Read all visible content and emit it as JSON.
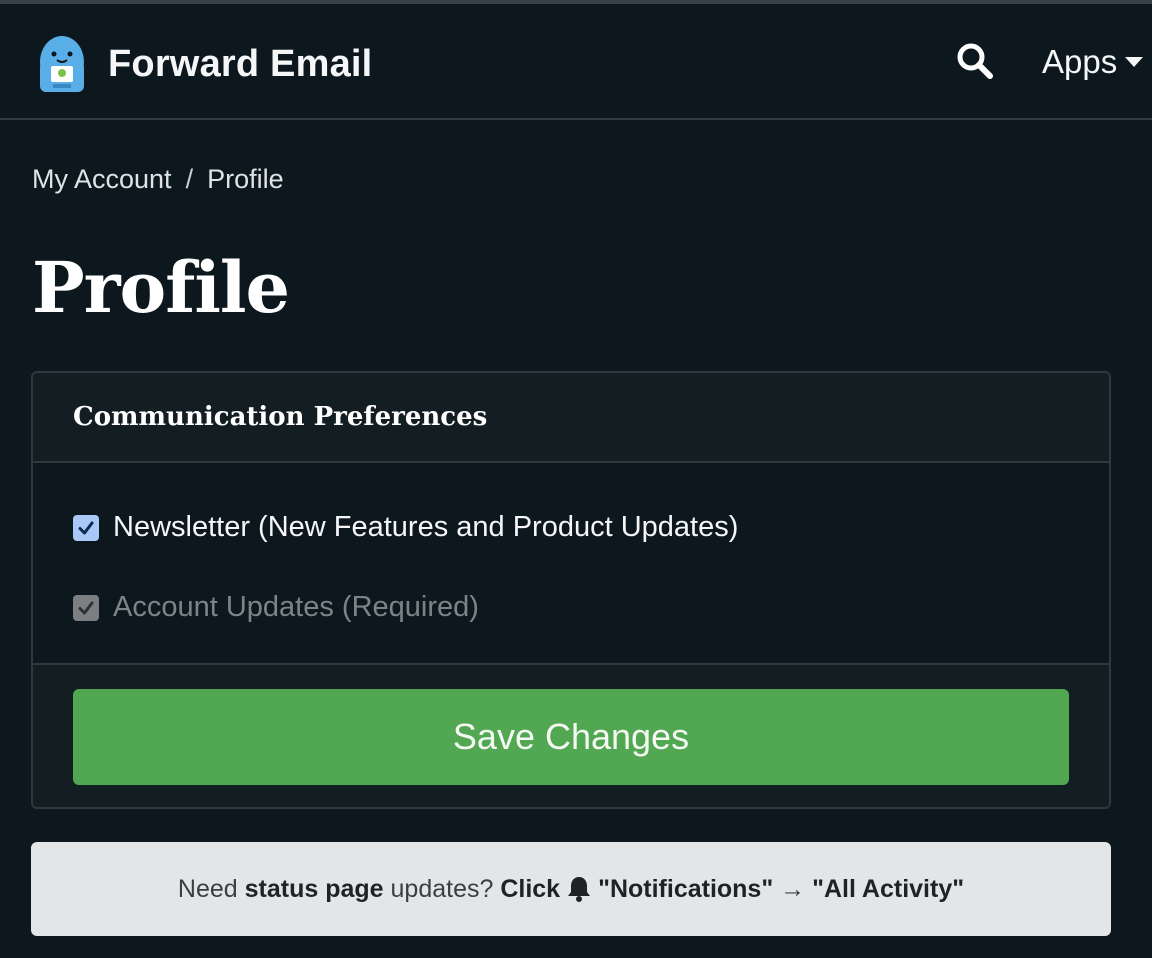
{
  "navbar": {
    "brand": "Forward Email",
    "search_icon": "search-icon",
    "apps_label": "Apps"
  },
  "breadcrumb": {
    "items": [
      "My Account",
      "Profile"
    ],
    "separator": "/"
  },
  "page_title": "Profile",
  "card": {
    "title": "Communication Preferences",
    "options": [
      {
        "label": "Newsletter (New Features and Product Updates)",
        "checked": true,
        "disabled": false
      },
      {
        "label": "Account Updates (Required)",
        "checked": true,
        "disabled": true
      }
    ],
    "save_label": "Save Changes"
  },
  "notice": {
    "part1": "Need ",
    "bold1": "status page",
    "part2": " updates? ",
    "bold2": "Click",
    "bell_icon": "bell-icon",
    "bold3": "\"Notifications\"",
    "arrow": " → ",
    "bold4": "\"All Activity\""
  },
  "colors": {
    "background": "#0c181e",
    "card_header": "#131e23",
    "save_button": "#52a752",
    "checkbox_active": "#a9c8f7",
    "notice_bg": "#e4e5e7"
  }
}
